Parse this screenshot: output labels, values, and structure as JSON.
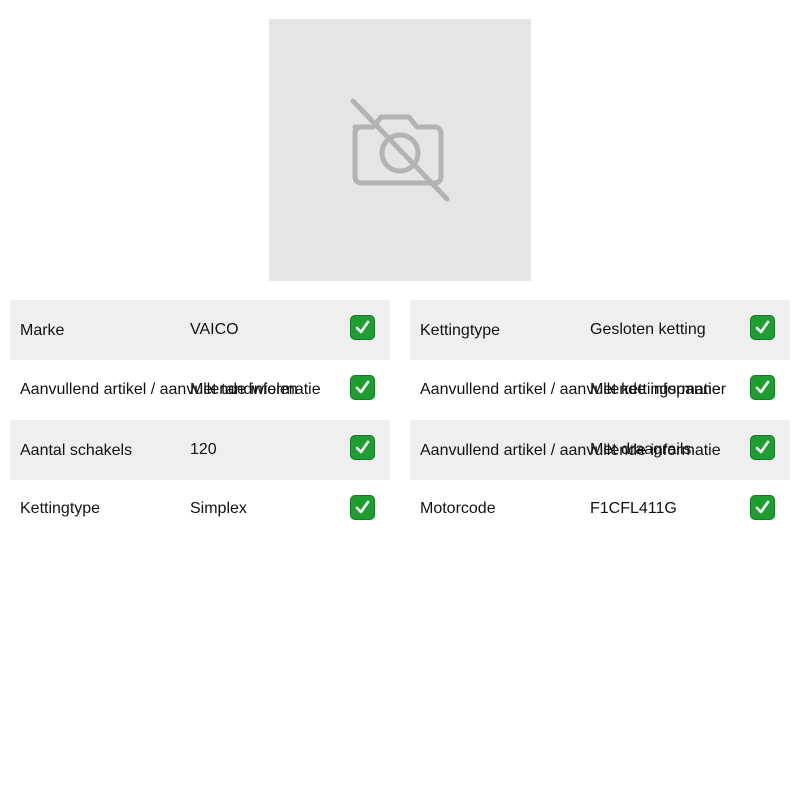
{
  "image": {
    "icon": "no-camera-icon"
  },
  "left_table": [
    {
      "label": "Marke",
      "value": "VAICO"
    },
    {
      "label": "Aanvullend artikel / aanvullende informatie",
      "value": "Met tandwielen"
    },
    {
      "label": "Aantal schakels",
      "value": "120"
    },
    {
      "label": "Kettingtype",
      "value": "Simplex"
    }
  ],
  "right_table": [
    {
      "label": "Kettingtype",
      "value": "Gesloten ketting"
    },
    {
      "label": "Aanvullend artikel / aanvullende informatie",
      "value": "Met kettingspanner"
    },
    {
      "label": "Aanvullend artikel / aanvullende informatie",
      "value": "Met draagrails"
    },
    {
      "label": "Motorcode",
      "value": "F1CFL411G"
    }
  ],
  "colors": {
    "check": "#1e9e31",
    "row_shade": "#efefef",
    "placeholder_bg": "#e5e5e5"
  }
}
